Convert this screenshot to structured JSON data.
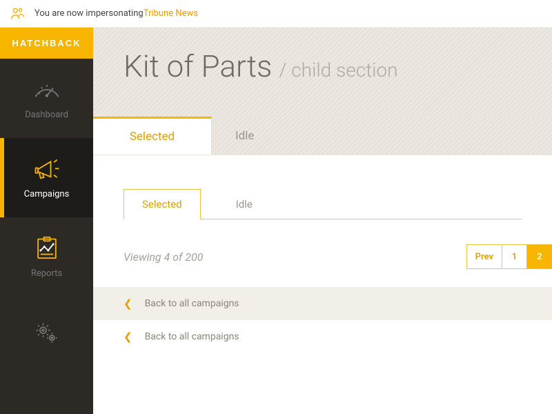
{
  "impersonate": {
    "prefix": "You are now impersonating ",
    "name": "Tribune News"
  },
  "brand": "HATCHBACK",
  "nav": [
    {
      "label": "Dashboard",
      "icon": "gauge"
    },
    {
      "label": "Campaigns",
      "icon": "megaphone"
    },
    {
      "label": "Reports",
      "icon": "chart-clipboard"
    },
    {
      "label": "",
      "icon": "gears"
    }
  ],
  "nav_active_index": 1,
  "header": {
    "title": "Kit of Parts",
    "subtitle": "/ child section"
  },
  "big_tabs": {
    "items": [
      "Selected",
      "Idle"
    ],
    "active_index": 0
  },
  "small_tabs": {
    "items": [
      "Selected",
      "Idle"
    ],
    "active_index": 0
  },
  "viewing": "Viewing 4 of 200",
  "pager": {
    "prev": "Prev",
    "pages": [
      "1",
      "2"
    ],
    "current_index": 1
  },
  "back_rows": [
    "Back to all campaigns",
    "Back to all campaigns"
  ],
  "colors": {
    "accent": "#f7b500",
    "accent_text": "#e2a000",
    "sidebar": "#2d2a26"
  }
}
